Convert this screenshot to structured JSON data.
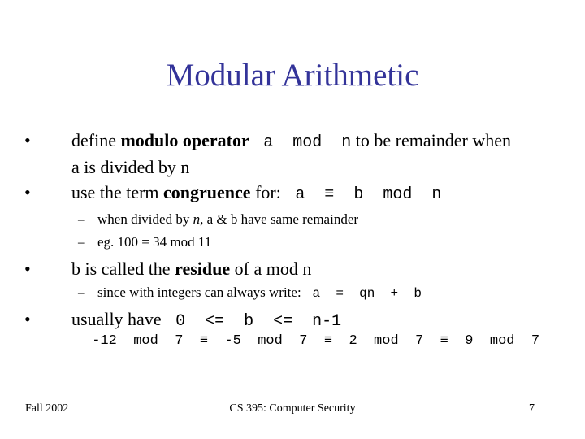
{
  "slide": {
    "title": "Modular Arithmetic",
    "title_color": "#333399",
    "bullets": [
      {
        "parts": [
          "define ",
          "modulo operator",
          " ",
          "a mod n",
          " to be remainder when"
        ],
        "line2": "a is divided by n"
      },
      {
        "parts": [
          "use the term ",
          "congruence",
          " for: ",
          "a ≡ b mod n"
        ]
      },
      {
        "parts": [
          "b is called the ",
          "residue",
          " of a mod n"
        ]
      },
      {
        "parts": [
          "usually have ",
          "0 <= b <= n-1"
        ]
      }
    ],
    "subbullets": [
      {
        "parts": [
          "when divided by ",
          "n,",
          " a & b have same remainder"
        ]
      },
      {
        "parts": [
          "eg. 100 = 34 mod 11"
        ]
      },
      {
        "parts": [
          "since with integers can always write: ",
          "a = qn + b"
        ]
      }
    ],
    "example": "-12 mod 7 ≡ -5 mod 7 ≡ 2 mod 7 ≡ 9 mod 7",
    "bullet_glyph": "•",
    "dash_glyph": "–"
  },
  "footer": {
    "left": "Fall 2002",
    "center": "CS 395: Computer Security",
    "right": "7"
  }
}
